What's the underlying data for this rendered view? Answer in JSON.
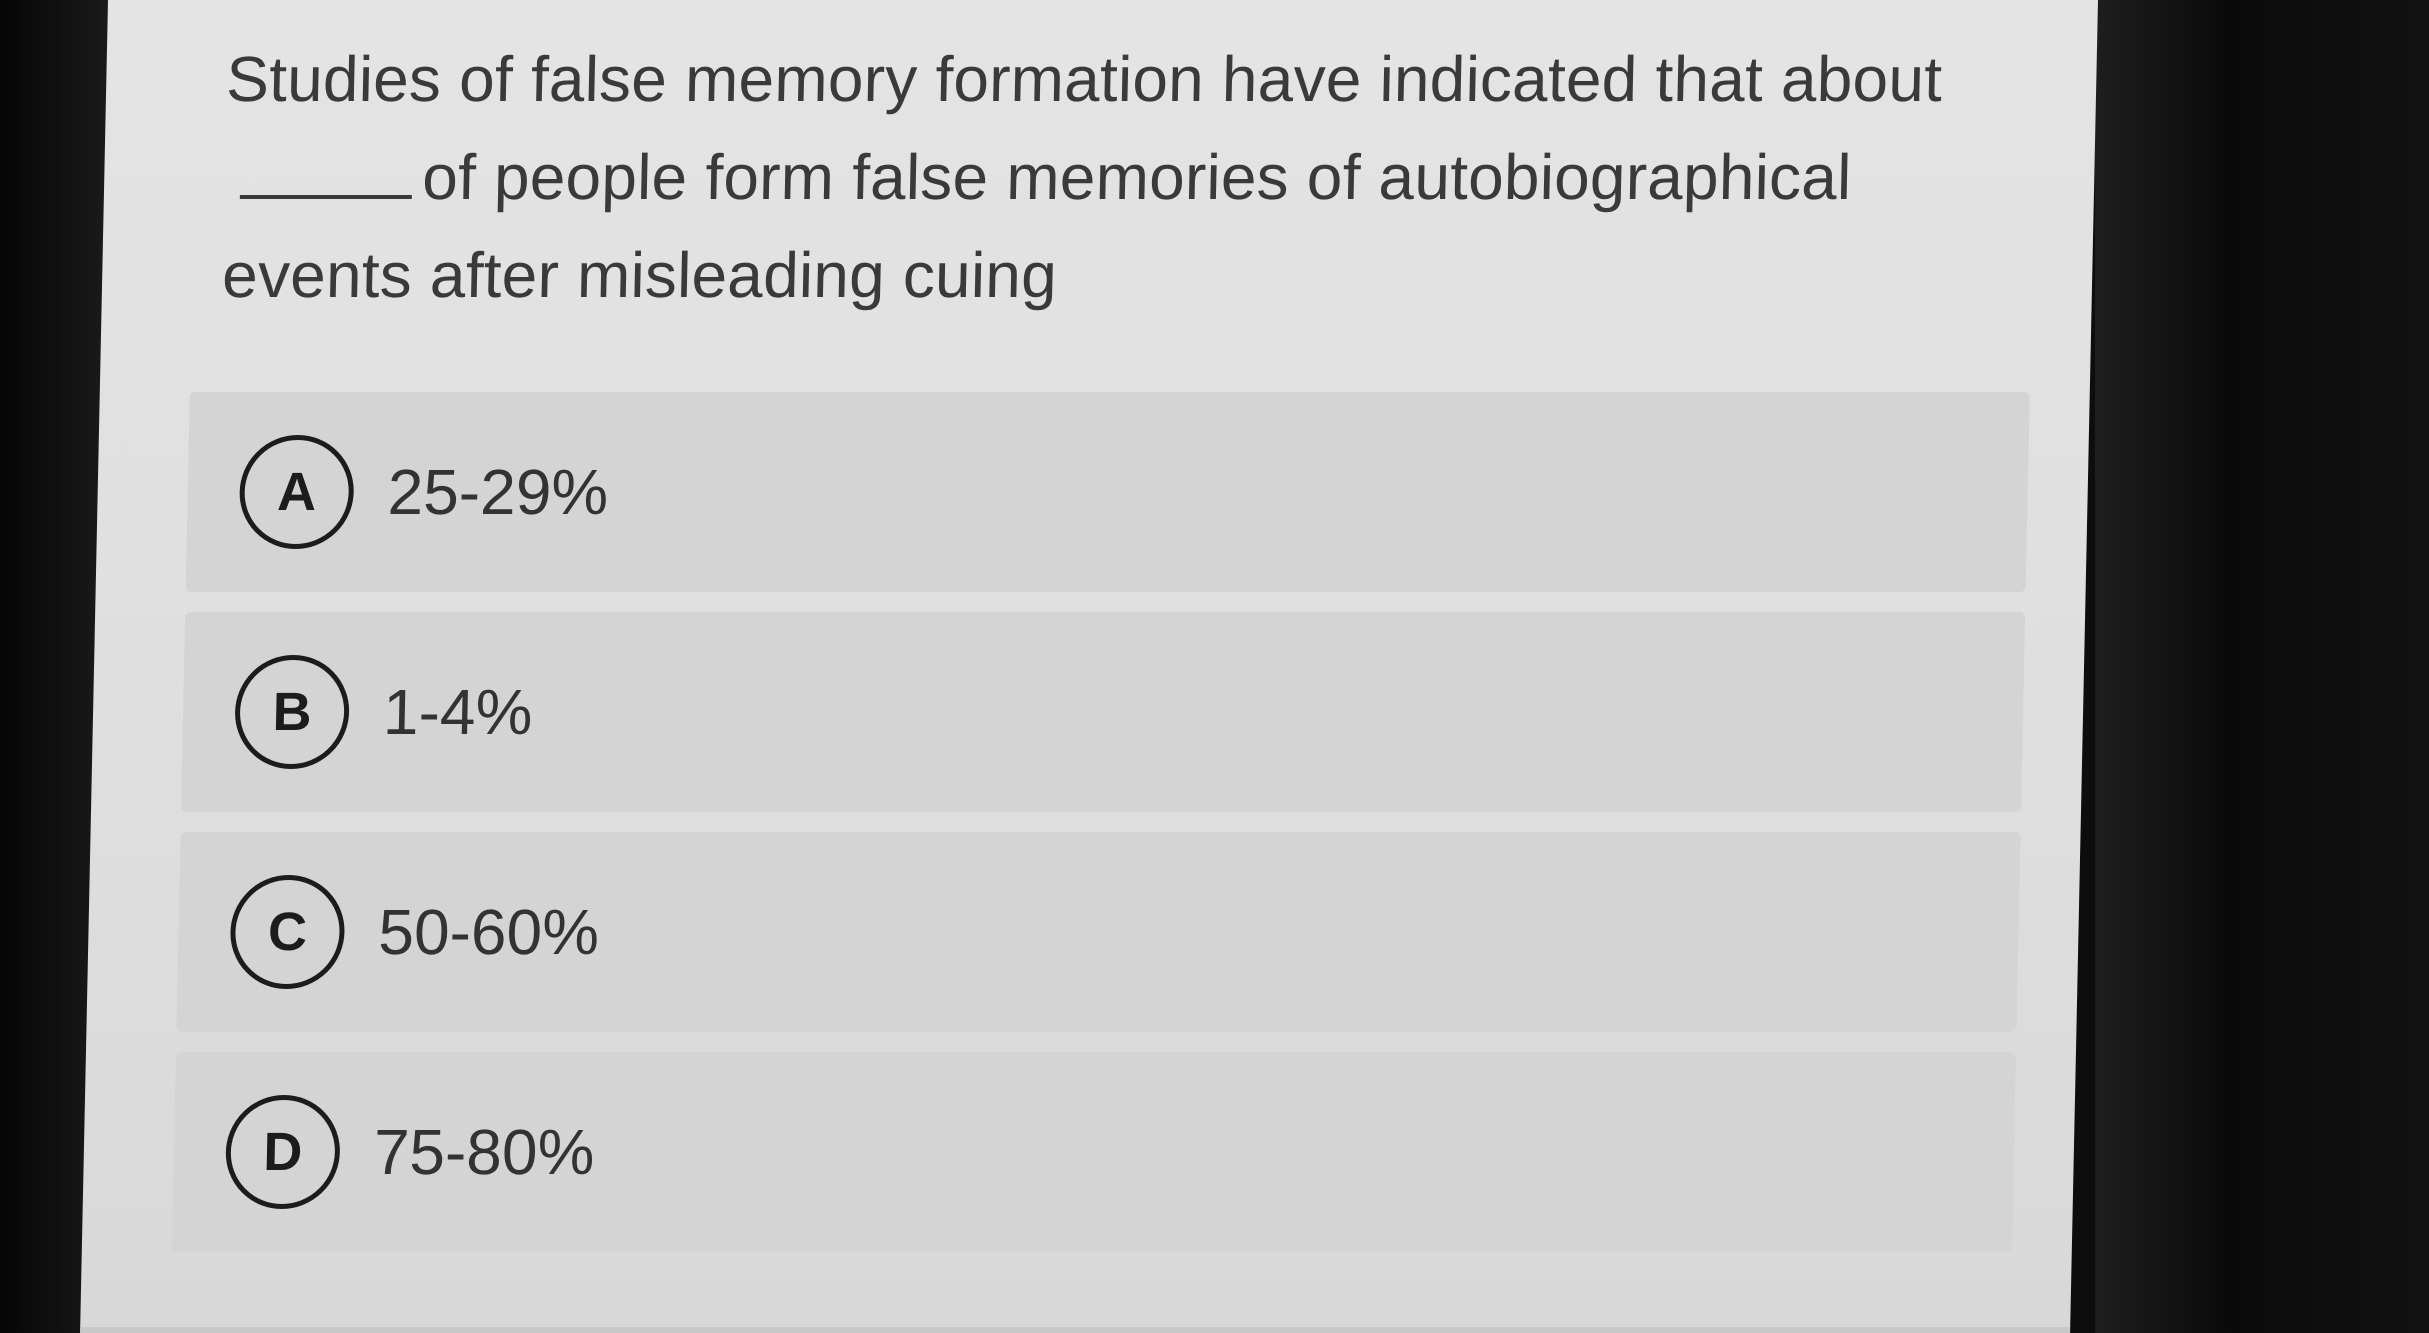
{
  "question": {
    "before_blank": "Studies of false memory formation have indicated that about",
    "after_blank": "of people form false memories of autobiographical events after misleading cuing"
  },
  "options": [
    {
      "letter": "A",
      "text": "25-29%"
    },
    {
      "letter": "B",
      "text": "1-4%"
    },
    {
      "letter": "C",
      "text": "50-60%"
    },
    {
      "letter": "D",
      "text": "75-80%"
    }
  ]
}
